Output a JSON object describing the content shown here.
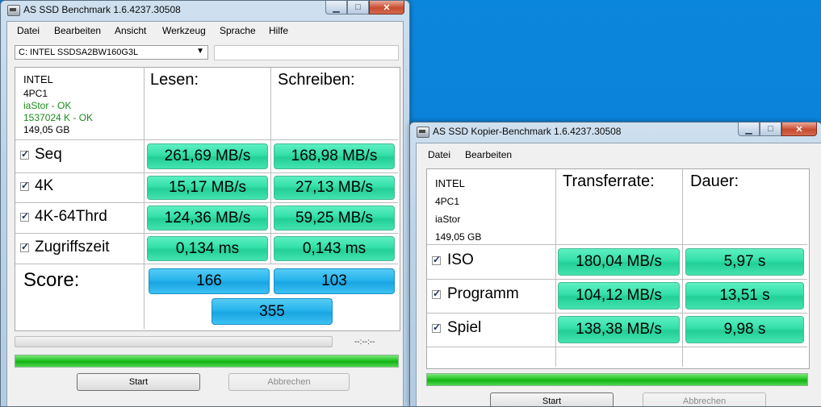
{
  "win1": {
    "title": "AS SSD Benchmark 1.6.4237.30508",
    "menu": [
      "Datei",
      "Bearbeiten",
      "Ansicht",
      "Werkzeug",
      "Sprache",
      "Hilfe"
    ],
    "drive_select": "C: INTEL SSDSA2BW160G3L",
    "info": [
      "INTEL",
      "4PC1",
      "iaStor - OK",
      "1537024 K - OK",
      "149,05 GB"
    ],
    "col_read": "Lesen:",
    "col_write": "Schreiben:",
    "rows": [
      {
        "label": "Seq",
        "read": "261,69 MB/s",
        "write": "168,98 MB/s"
      },
      {
        "label": "4K",
        "read": "15,17 MB/s",
        "write": "27,13 MB/s"
      },
      {
        "label": "4K-64Thrd",
        "read": "124,36 MB/s",
        "write": "59,25 MB/s"
      },
      {
        "label": "Zugriffszeit",
        "read": "0,134 ms",
        "write": "0,143 ms"
      }
    ],
    "score_label": "Score:",
    "score_read": "166",
    "score_write": "103",
    "score_total": "355",
    "time": "--:--:--",
    "progress_value": 1.0,
    "start": "Start",
    "abort": "Abbrechen"
  },
  "win2": {
    "title": "AS SSD Kopier-Benchmark 1.6.4237.30508",
    "menu": [
      "Datei",
      "Bearbeiten"
    ],
    "info": [
      "INTEL",
      "4PC1",
      "iaStor",
      "149,05 GB"
    ],
    "col_rate": "Transferrate:",
    "col_time": "Dauer:",
    "rows": [
      {
        "label": "ISO",
        "rate": "180,04 MB/s",
        "time": "5,97 s"
      },
      {
        "label": "Programm",
        "rate": "104,12 MB/s",
        "time": "13,51 s"
      },
      {
        "label": "Spiel",
        "rate": "138,38 MB/s",
        "time": "9,98 s"
      }
    ],
    "progress_value": 1.0,
    "start": "Start",
    "abort": "Abbrechen"
  },
  "colors": {
    "desktop": "#0a7fd6",
    "result": "#33dfa8",
    "score": "#27b4ec",
    "progress": "#23c523"
  }
}
